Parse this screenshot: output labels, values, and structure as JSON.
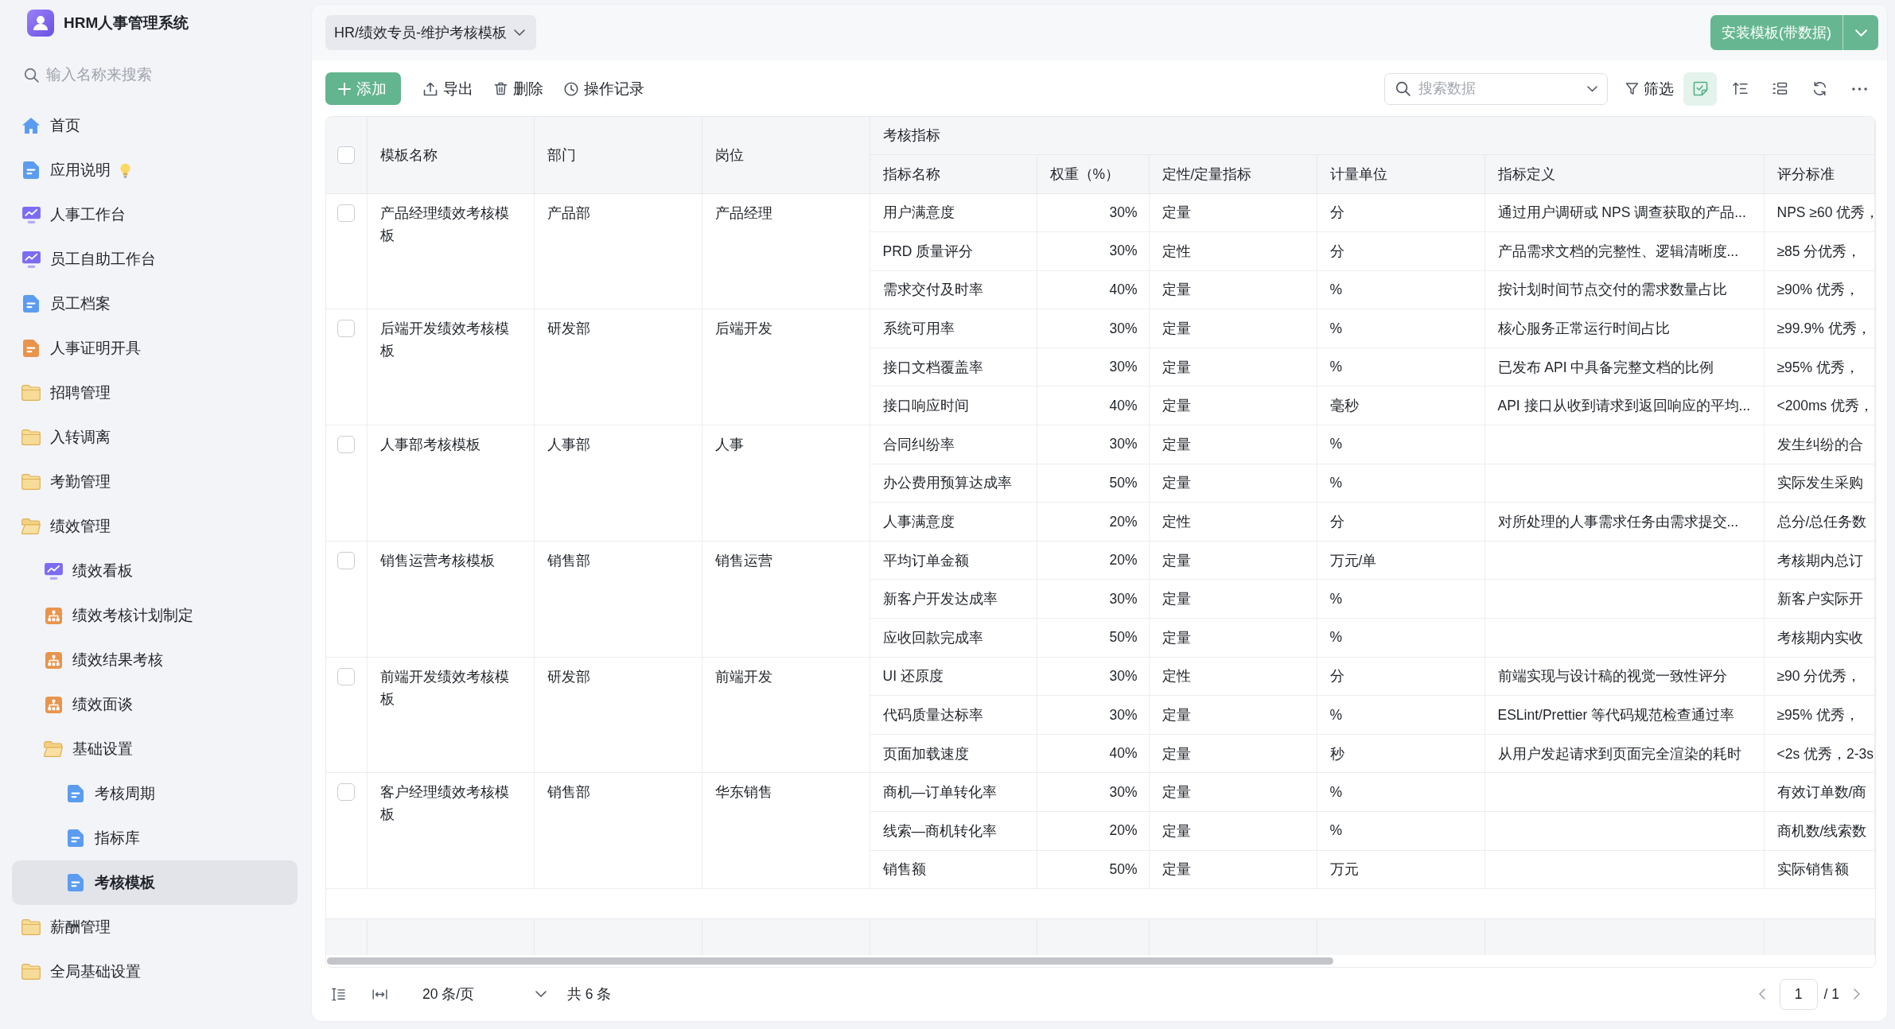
{
  "app": {
    "title": "HRM人事管理系统"
  },
  "sidebar": {
    "search": {
      "placeholder": "输入名称来搜索"
    },
    "items": [
      {
        "label": "首页",
        "kind": "home",
        "selected": false
      },
      {
        "label": "应用说明",
        "kind": "page",
        "selected": false,
        "tip": true
      },
      {
        "label": "人事工作台",
        "kind": "dashboard",
        "selected": false
      },
      {
        "label": "员工自助工作台",
        "kind": "dashboard",
        "selected": false
      },
      {
        "label": "员工档案",
        "kind": "page",
        "selected": false
      },
      {
        "label": "人事证明开具",
        "kind": "form",
        "selected": false
      },
      {
        "label": "招聘管理",
        "kind": "folder",
        "selected": false,
        "expanded": false
      },
      {
        "label": "入转调离",
        "kind": "folder",
        "selected": false,
        "expanded": false
      },
      {
        "label": "考勤管理",
        "kind": "folder",
        "selected": false,
        "expanded": false
      },
      {
        "label": "绩效管理",
        "kind": "folder",
        "selected": false,
        "expanded": true,
        "children": [
          {
            "label": "绩效看板",
            "kind": "dashboard",
            "selected": false
          },
          {
            "label": "绩效考核计划制定",
            "kind": "process",
            "selected": false
          },
          {
            "label": "绩效结果考核",
            "kind": "process",
            "selected": false
          },
          {
            "label": "绩效面谈",
            "kind": "process",
            "selected": false
          },
          {
            "label": "基础设置",
            "kind": "folder",
            "selected": false,
            "expanded": true,
            "children": [
              {
                "label": "考核周期",
                "kind": "page",
                "selected": false
              },
              {
                "label": "指标库",
                "kind": "page",
                "selected": false
              },
              {
                "label": "考核模板",
                "kind": "page",
                "selected": true
              }
            ]
          }
        ]
      },
      {
        "label": "薪酬管理",
        "kind": "folder",
        "selected": false,
        "expanded": false
      },
      {
        "label": "全局基础设置",
        "kind": "folder",
        "selected": false,
        "expanded": false
      }
    ]
  },
  "header": {
    "breadcrumb": "HR/绩效专员-维护考核模板",
    "install_button": "安装模板(带数据)"
  },
  "toolbar": {
    "actions": [
      {
        "kind": "add",
        "label": "添加"
      },
      {
        "kind": "export",
        "label": "导出"
      },
      {
        "kind": "delete",
        "label": "删除"
      },
      {
        "kind": "history",
        "label": "操作记录"
      }
    ],
    "search": {
      "placeholder": "搜索数据"
    },
    "filter": "筛选",
    "tools": [
      {
        "kind": "note",
        "selected": true
      },
      {
        "kind": "sort",
        "selected": false
      },
      {
        "kind": "list",
        "selected": false
      },
      {
        "kind": "refresh",
        "selected": false
      },
      {
        "kind": "more",
        "selected": false
      }
    ]
  },
  "table": {
    "select_all": {
      "checked": false
    },
    "columns": [
      "模板名称",
      "部门",
      "岗位"
    ],
    "group": {
      "label": "考核指标",
      "columns": [
        "指标名称",
        "权重（%）",
        "定性/定量指标",
        "计量单位",
        "指标定义",
        "评分标准"
      ]
    },
    "rows": [
      {
        "checked": false,
        "name": "产品经理绩效考核模板",
        "department": "产品部",
        "position": "产品经理",
        "indicators": [
          {
            "name": "用户满意度",
            "weight": "30%",
            "type": "定量",
            "unit": "分",
            "definition": "通过用户调研或 NPS 调查获取的产品...",
            "criteria": "NPS ≥60 优秀，"
          },
          {
            "name": "PRD 质量评分",
            "weight": "30%",
            "type": "定性",
            "unit": "分",
            "definition": "产品需求文档的完整性、逻辑清晰度...",
            "criteria": "≥85 分优秀，"
          },
          {
            "name": "需求交付及时率",
            "weight": "40%",
            "type": "定量",
            "unit": "%",
            "definition": "按计划时间节点交付的需求数量占比",
            "criteria": "≥90% 优秀，"
          }
        ]
      },
      {
        "checked": false,
        "name": "后端开发绩效考核模板",
        "department": "研发部",
        "position": "后端开发",
        "indicators": [
          {
            "name": "系统可用率",
            "weight": "30%",
            "type": "定量",
            "unit": "%",
            "definition": "核心服务正常运行时间占比",
            "criteria": "≥99.9% 优秀，"
          },
          {
            "name": "接口文档覆盖率",
            "weight": "30%",
            "type": "定量",
            "unit": "%",
            "definition": "已发布 API 中具备完整文档的比例",
            "criteria": "≥95% 优秀，"
          },
          {
            "name": "接口响应时间",
            "weight": "40%",
            "type": "定量",
            "unit": "毫秒",
            "definition": "API 接口从收到请求到返回响应的平均...",
            "criteria": "<200ms 优秀，"
          }
        ]
      },
      {
        "checked": false,
        "name": "人事部考核模板",
        "department": "人事部",
        "position": "人事",
        "indicators": [
          {
            "name": "合同纠纷率",
            "weight": "30%",
            "type": "定量",
            "unit": "%",
            "criteria": "发生纠纷的合"
          },
          {
            "name": "办公费用预算达成率",
            "weight": "50%",
            "type": "定量",
            "unit": "%",
            "criteria": "实际发生采购"
          },
          {
            "name": "人事满意度",
            "weight": "20%",
            "type": "定性",
            "unit": "分",
            "definition": "对所处理的人事需求任务由需求提交...",
            "criteria": "总分/总任务数"
          }
        ]
      },
      {
        "checked": false,
        "name": "销售运营考核模板",
        "department": "销售部",
        "position": "销售运营",
        "indicators": [
          {
            "name": "平均订单金额",
            "weight": "20%",
            "type": "定量",
            "unit": "万元/单",
            "criteria": "考核期内总订"
          },
          {
            "name": "新客户开发达成率",
            "weight": "30%",
            "type": "定量",
            "unit": "%",
            "criteria": "新客户实际开"
          },
          {
            "name": "应收回款完成率",
            "weight": "50%",
            "type": "定量",
            "unit": "%",
            "criteria": "考核期内实收"
          }
        ]
      },
      {
        "checked": false,
        "name": "前端开发绩效考核模板",
        "department": "研发部",
        "position": "前端开发",
        "indicators": [
          {
            "name": "UI 还原度",
            "weight": "30%",
            "type": "定性",
            "unit": "分",
            "definition": "前端实现与设计稿的视觉一致性评分",
            "criteria": "≥90 分优秀，"
          },
          {
            "name": "代码质量达标率",
            "weight": "30%",
            "type": "定量",
            "unit": "%",
            "definition": "ESLint/Prettier 等代码规范检查通过率",
            "criteria": "≥95% 优秀，"
          },
          {
            "name": "页面加载速度",
            "weight": "40%",
            "type": "定量",
            "unit": "秒",
            "definition": "从用户发起请求到页面完全渲染的耗时",
            "criteria": "<2s 优秀，2-3s"
          }
        ]
      },
      {
        "checked": false,
        "name": "客户经理绩效考核模板",
        "department": "销售部",
        "position": "华东销售",
        "indicators": [
          {
            "name": "商机—订单转化率",
            "weight": "30%",
            "type": "定量",
            "unit": "%",
            "criteria": "有效订单数/商"
          },
          {
            "name": "线索—商机转化率",
            "weight": "20%",
            "type": "定量",
            "unit": "%",
            "criteria": "商机数/线索数"
          },
          {
            "name": "销售额",
            "weight": "50%",
            "type": "定量",
            "unit": "万元",
            "criteria": "实际销售额"
          }
        ]
      }
    ]
  },
  "pagination": {
    "page_size": "20 条/页",
    "total": "共 6 条",
    "current": "1",
    "pages": "/ 1"
  }
}
